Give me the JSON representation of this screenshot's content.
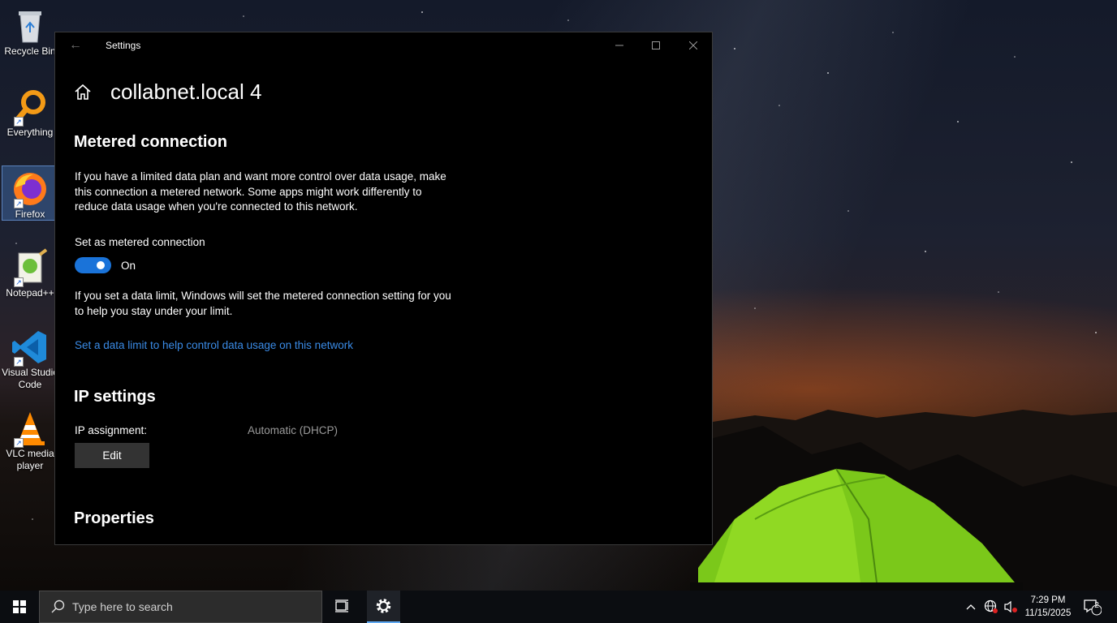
{
  "desktop": {
    "icons": [
      {
        "label": "Recycle Bin"
      },
      {
        "label": "Everything"
      },
      {
        "label": "Firefox"
      },
      {
        "label": "Notepad++"
      },
      {
        "label": "Visual Studio Code"
      },
      {
        "label": "VLC media player"
      }
    ]
  },
  "window": {
    "title": "Settings",
    "page_title": "collabnet.local 4"
  },
  "metered": {
    "heading": "Metered connection",
    "description": "If you have a limited data plan and want more control over data usage, make this connection a metered network. Some apps might work differently to reduce data usage when you're connected to this network.",
    "toggle_label": "Set as metered connection",
    "toggle_state": "On",
    "limit_note": "If you set a data limit, Windows will set the metered connection setting for you to help you stay under your limit.",
    "limit_link": "Set a data limit to help control data usage on this network"
  },
  "ip": {
    "heading": "IP settings",
    "assignment_label": "IP assignment:",
    "assignment_value": "Automatic (DHCP)",
    "edit_label": "Edit"
  },
  "properties": {
    "heading": "Properties"
  },
  "taskbar": {
    "search_placeholder": "Type here to search",
    "time": "7:29 PM",
    "date": "11/15/2025",
    "notification_count": "2"
  },
  "colors": {
    "accent": "#1a73d9",
    "link": "#3a8be6",
    "window_bg": "#000000"
  }
}
